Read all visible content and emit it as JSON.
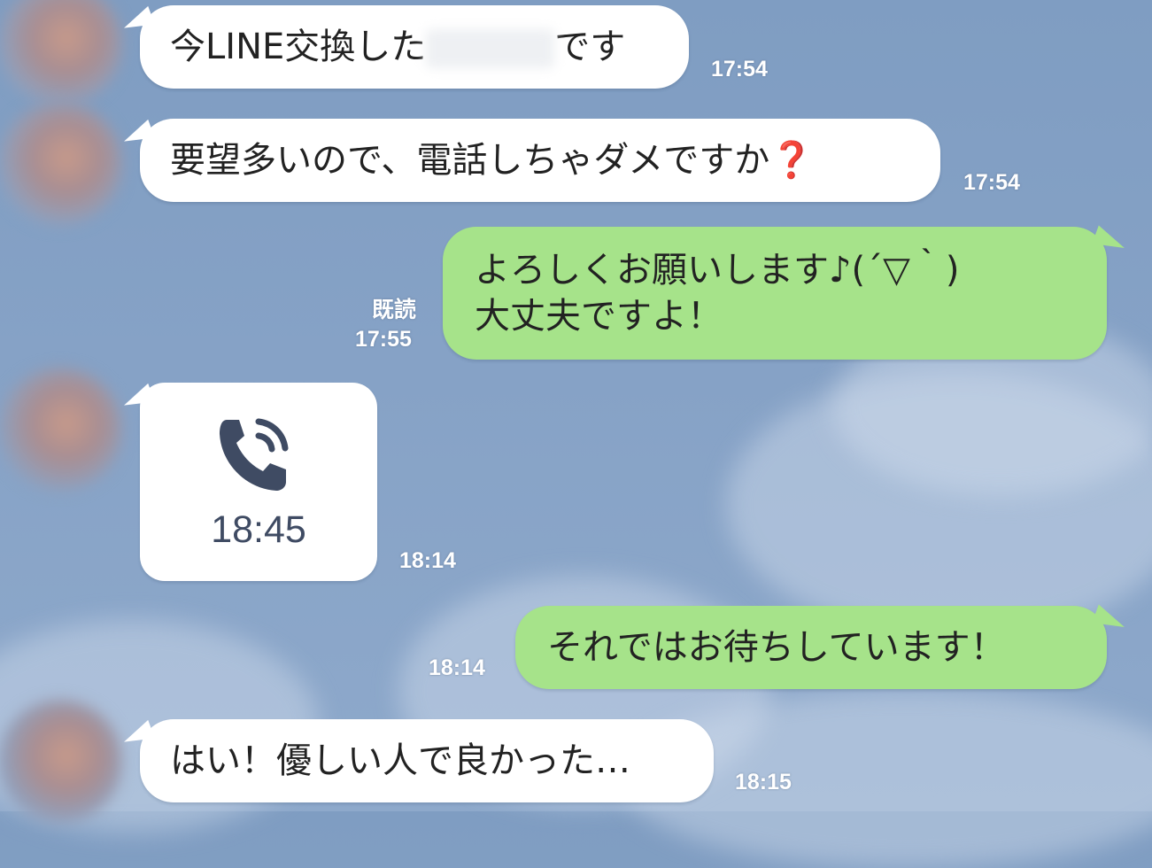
{
  "messages": [
    {
      "dir": "in",
      "text_before": "今LINE交換した",
      "text_after": "です",
      "time": "17:54"
    },
    {
      "dir": "in",
      "text": "要望多いので、電話しちゃダメですか",
      "emoji": "❓",
      "time": "17:54"
    },
    {
      "dir": "out",
      "line1": "よろしくお願いします♪(´▽｀)",
      "line2": "大丈夫ですよ！",
      "read": "既読",
      "time": "17:55"
    },
    {
      "dir": "in",
      "call_duration": "18:45",
      "icon": "phone-call-icon",
      "time": "18:14"
    },
    {
      "dir": "out",
      "text": "それではお待ちしています！",
      "time": "18:14"
    },
    {
      "dir": "in",
      "text": "はい！優しい人で良かった…",
      "time": "18:15"
    }
  ],
  "colors": {
    "outgoing_bubble": "#a6e38a",
    "incoming_bubble": "#ffffff",
    "background": "#86a2c6",
    "call_icon": "#3f4b63"
  }
}
